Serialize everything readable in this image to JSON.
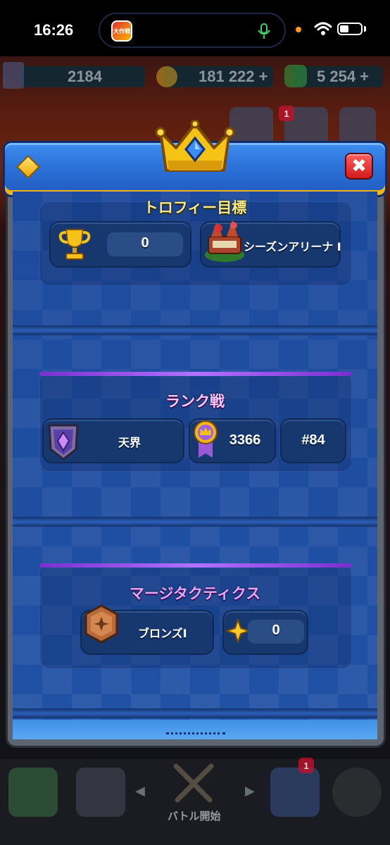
{
  "status_bar": {
    "time": "16:26",
    "app_icon_text": "大作戦"
  },
  "resources": {
    "trophies": "2184",
    "gold": "181 222 +",
    "gems": "5 254 +"
  },
  "top_notification": "1",
  "modal": {
    "accent_color": "#2c72d8",
    "gold_border": "#f2b21b",
    "close_label": "✖",
    "trophy_section": {
      "title": "トロフィー目標",
      "trophy_value": "0",
      "arena_label": "シーズンアリーナ I"
    },
    "ranked_section": {
      "title": "ランク戦",
      "league_label": "天界",
      "rating_value": "3366",
      "rank_value": "#84"
    },
    "merge_section": {
      "title": "マージタクティクス",
      "tier_label": "ブロンズI",
      "star_value": "0"
    }
  },
  "bottom_nav": {
    "battle_label": "バトル開始",
    "clan_notification": "1"
  }
}
